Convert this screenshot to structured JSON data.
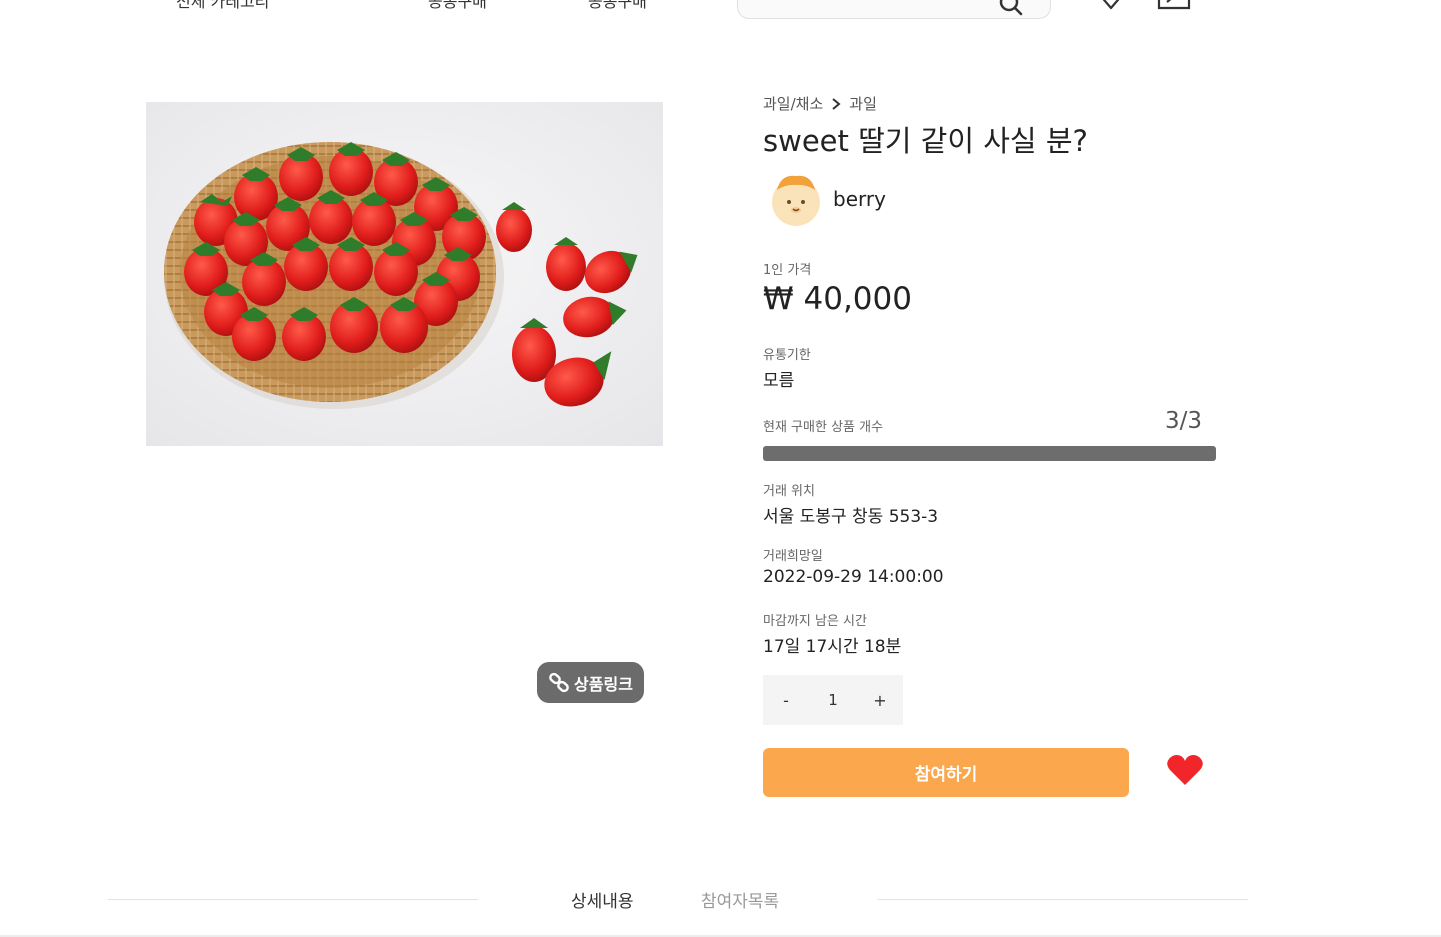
{
  "header": {
    "nav_items": [
      "전체 카테고리",
      "공동구매",
      "공동구매"
    ]
  },
  "link_button": {
    "label": "상품링크"
  },
  "breadcrumb": {
    "category": "과일/채소",
    "subcategory": "과일"
  },
  "product": {
    "title": "sweet 딸기 같이 사실 분?",
    "seller": "berry",
    "price_label": "1인 가격",
    "price": "₩ 40,000",
    "expiry_label": "유통기한",
    "expiry": "모름",
    "count_label": "현재 구매한 상품 개수",
    "count": "3/3",
    "count_progress": 1.0,
    "location_label": "거래 위치",
    "location": "서울 도봉구 창동 553-3",
    "date_label": "거래희망일",
    "date": "2022-09-29 14:00:00",
    "remaining_label": "마감까지 남은 시간",
    "remaining": "17일 17시간 18분"
  },
  "stepper": {
    "minus": "-",
    "value": "1",
    "plus": "+"
  },
  "join_button": {
    "label": "참여하기"
  },
  "tabs": [
    {
      "label": "상세내용",
      "active": true
    },
    {
      "label": "참여자목록",
      "active": false
    }
  ],
  "colors": {
    "accent": "#faa74e",
    "heart": "#f0262a",
    "progress": "#6d6d6d",
    "link_button": "#6b6b6b"
  }
}
